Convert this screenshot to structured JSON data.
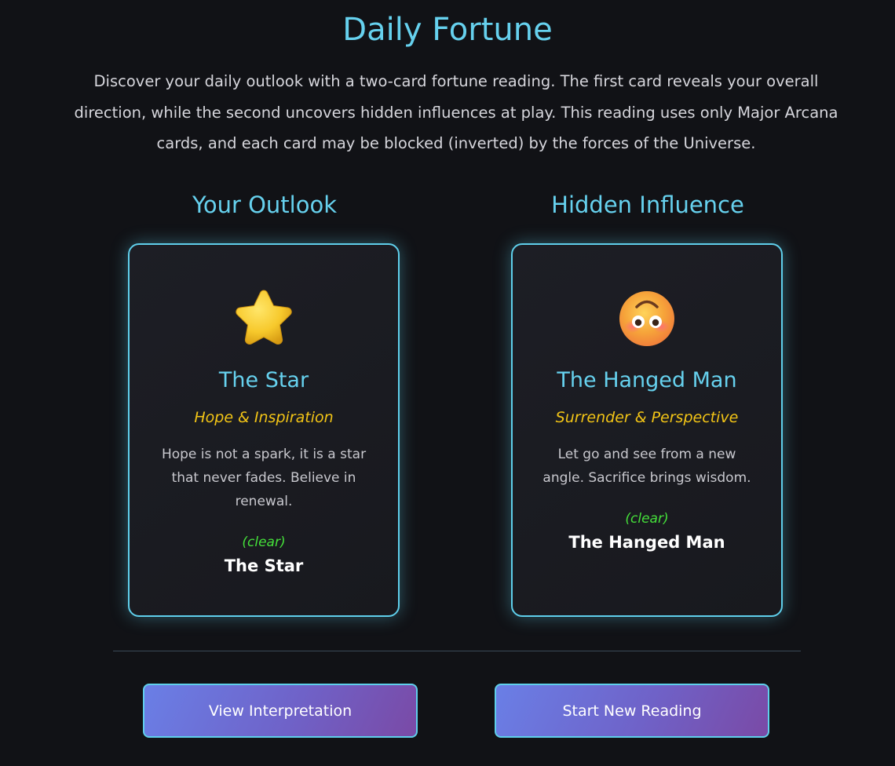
{
  "page": {
    "title": "Daily Fortune",
    "intro": "Discover your daily outlook with a two-card fortune reading. The first card reveals your overall direction, while the second uncovers hidden influences at play. This reading uses only Major Arcana cards, and each card may be blocked (inverted) by the forces of the Universe."
  },
  "cards": [
    {
      "heading": "Your Outlook",
      "icon": "star-emoji-icon",
      "name": "The Star",
      "keywords": "Hope & Inspiration",
      "message": "Hope is not a spark, it is a star that never fades. Believe in renewal.",
      "status": "(clear)",
      "result": "The Star"
    },
    {
      "heading": "Hidden Influence",
      "icon": "upside-down-face-emoji-icon",
      "name": "The Hanged Man",
      "keywords": "Surrender & Perspective",
      "message": "Let go and see from a new angle. Sacrifice brings wisdom.",
      "status": "(clear)",
      "result": "The Hanged Man"
    }
  ],
  "actions": {
    "view_label": "View Interpretation",
    "new_label": "Start New Reading"
  },
  "colors": {
    "background": "#111216",
    "accent": "#66d1ee",
    "keywords": "#f2c416",
    "status_clear": "#45e03a"
  }
}
